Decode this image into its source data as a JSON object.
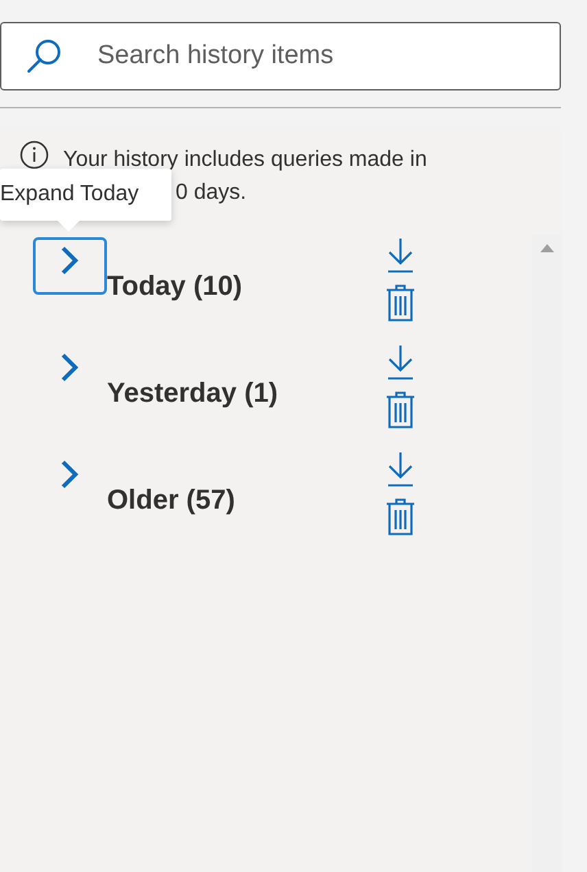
{
  "search": {
    "placeholder": "Search history items"
  },
  "info": {
    "line_1": "Your history includes queries made in",
    "line_2": "0 days."
  },
  "tooltip": {
    "text": "Expand Today"
  },
  "groups": [
    {
      "label": "Today (10)",
      "focused": true
    },
    {
      "label": "Yesterday (1)",
      "focused": false
    },
    {
      "label": "Older (57)",
      "focused": false
    }
  ]
}
